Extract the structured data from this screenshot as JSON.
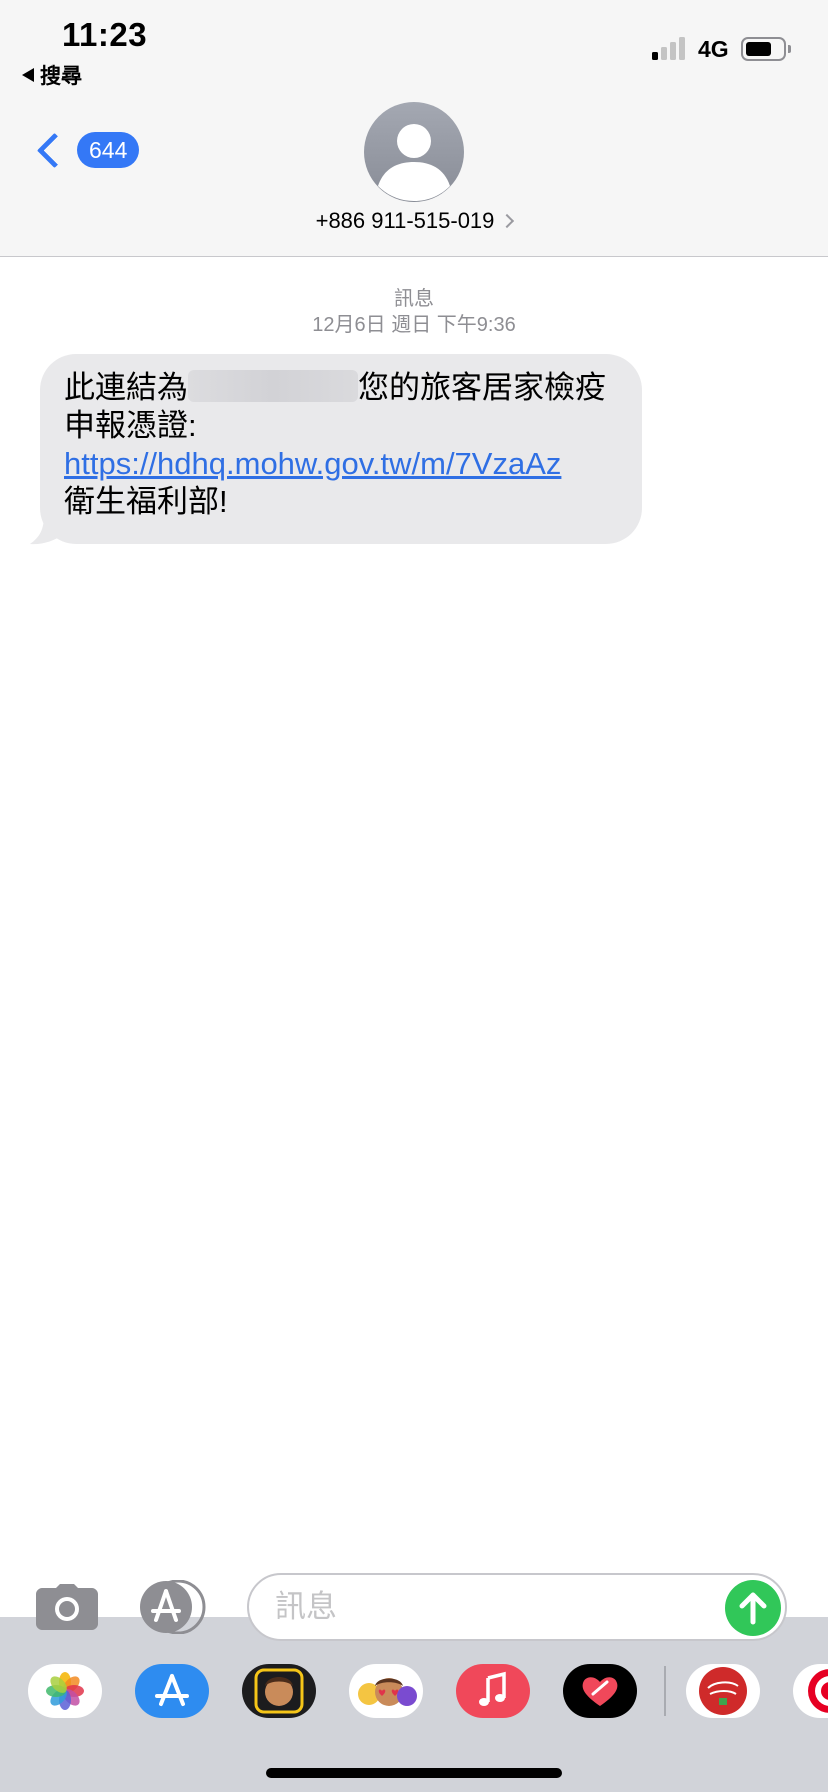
{
  "status_bar": {
    "time": "11:23",
    "back_app": "搜尋",
    "network": "4G",
    "signal_bars_on": 1,
    "signal_bars_total": 4
  },
  "nav": {
    "unread_count": "644",
    "contact": "+886 911-515-019"
  },
  "conversation": {
    "label": "訊息",
    "timestamp": "12月6日 週日 下午9:36"
  },
  "message": {
    "text_before": "此連結為",
    "text_after": "您的旅客居家檢疫申報憑證:",
    "link": "https://hdhq.mohw.gov.tw/m/7VzaAz",
    "text_end": "衛生福利部!"
  },
  "composer": {
    "placeholder": "訊息"
  },
  "app_drawer": {
    "icons": [
      "photos-icon",
      "app-store-icon",
      "memoji-icon",
      "animoji-stickers-icon",
      "music-icon",
      "digital-touch-icon",
      "we-are-family-icon",
      "pinterest-icon"
    ]
  },
  "colors": {
    "ios_blue": "#3478f6",
    "send_green": "#31c759",
    "bubble_gray": "#e9e9eb",
    "link_blue": "#2f6fe4"
  }
}
